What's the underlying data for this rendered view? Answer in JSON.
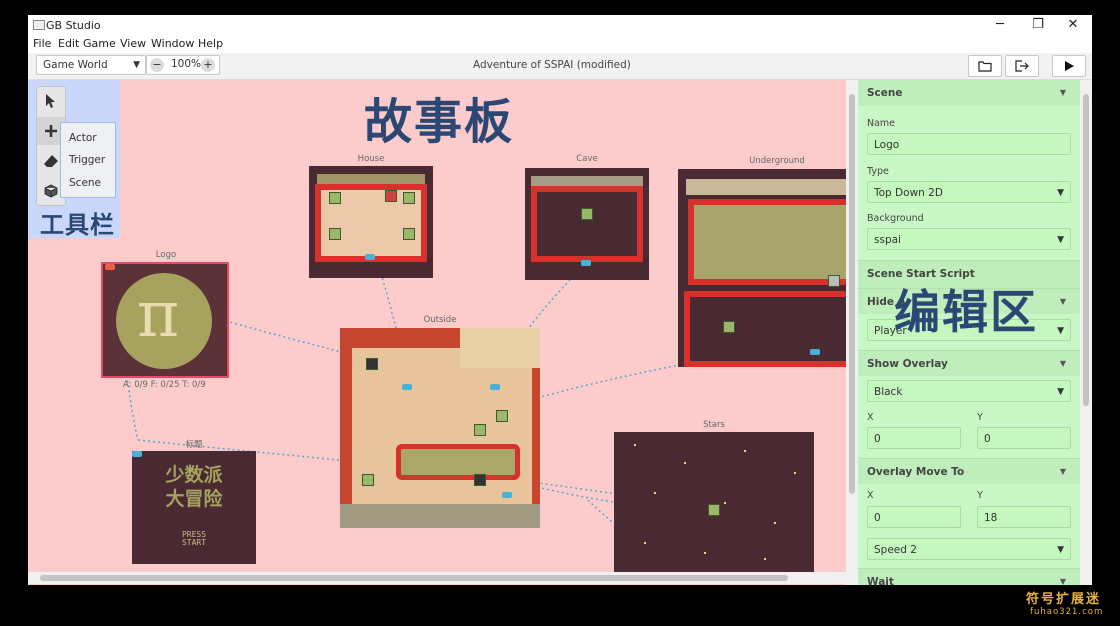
{
  "window": {
    "title": "GB Studio",
    "controls": {
      "minimize": "─",
      "maximize": "❐",
      "close": "✕"
    }
  },
  "menu": [
    "File",
    "Edit",
    "Game",
    "View",
    "Window",
    "Help"
  ],
  "toolbar": {
    "world_select": "Game World",
    "zoom_minus": "−",
    "zoom_value": "100%",
    "zoom_plus": "+",
    "document_title": "Adventure of SSPAI (modified)",
    "open_folder_icon": "folder-icon",
    "export_icon": "export-icon",
    "play_icon": "play-icon"
  },
  "tools": {
    "items": [
      "select",
      "add",
      "eraser",
      "entities"
    ],
    "add_menu": [
      "Actor",
      "Trigger",
      "Scene"
    ],
    "annotation": "工具栏"
  },
  "canvas": {
    "annotation": "故事板",
    "scenes": [
      {
        "name": "Logo",
        "stats": "A: 0/9   F: 0/25   T: 0/9",
        "logo_glyph": "π"
      },
      {
        "name": "标题",
        "title_line1": "少数派",
        "title_line2": "大冒险",
        "press_start": "PRESS\nSTART"
      },
      {
        "name": "House"
      },
      {
        "name": "Cave"
      },
      {
        "name": "Underground"
      },
      {
        "name": "Outside"
      },
      {
        "name": "Stars"
      }
    ]
  },
  "panel": {
    "annotation": "编辑区",
    "scene_header": "Scene",
    "name_label": "Name",
    "name_value": "Logo",
    "type_label": "Type",
    "type_value": "Top Down 2D",
    "background_label": "Background",
    "background_value": "sspai",
    "start_script_header": "Scene Start Script",
    "hide_actor_header": "Hide A",
    "hide_actor_value": "Player",
    "show_overlay_header": "Show Overlay",
    "show_overlay_value": "Black",
    "x_label": "X",
    "y_label": "Y",
    "overlay_x": "0",
    "overlay_y": "0",
    "overlay_move_header": "Overlay Move To",
    "move_x": "0",
    "move_y": "18",
    "speed_value": "Speed 2",
    "wait_header": "Wait"
  },
  "watermark": {
    "line1": "符号扩展迷",
    "line2": "fuhao321.com"
  },
  "colors": {
    "canvas_bg": "#fccccc",
    "panel_bg": "#c9f7c5",
    "tools_bg": "#c9d8fa",
    "annotation": "#2b4774",
    "scene_red": "#d8312c",
    "scene_dark": "#4a2a32"
  }
}
